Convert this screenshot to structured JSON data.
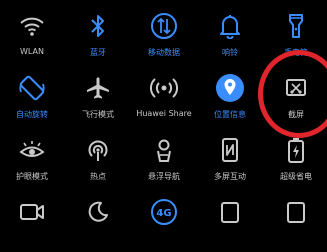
{
  "rows": [
    [
      {
        "label": "WLAN",
        "icon": "wifi-icon",
        "active": false
      },
      {
        "label": "蓝牙",
        "icon": "bluetooth-icon",
        "active": true
      },
      {
        "label": "移动数据",
        "icon": "mobile-data-icon",
        "active": true
      },
      {
        "label": "响铃",
        "icon": "bell-icon",
        "active": true
      },
      {
        "label": "手电筒",
        "icon": "flashlight-icon",
        "active": true
      }
    ],
    [
      {
        "label": "自动旋转",
        "icon": "auto-rotate-icon",
        "active": true
      },
      {
        "label": "飞行模式",
        "icon": "airplane-icon",
        "active": false
      },
      {
        "label": "Huawei Share",
        "icon": "huawei-share-icon",
        "active": false
      },
      {
        "label": "位置信息",
        "icon": "location-icon",
        "active": true
      },
      {
        "label": "截屏",
        "icon": "screenshot-icon",
        "active": false
      }
    ],
    [
      {
        "label": "护眼模式",
        "icon": "eye-comfort-icon",
        "active": false
      },
      {
        "label": "热点",
        "icon": "hotspot-icon",
        "active": false
      },
      {
        "label": "悬浮导航",
        "icon": "floating-nav-icon",
        "active": false
      },
      {
        "label": "多屏互动",
        "icon": "multi-screen-icon",
        "active": false
      },
      {
        "label": "超级省电",
        "icon": "super-power-saving-icon",
        "active": false
      }
    ],
    [
      {
        "label": "",
        "icon": "screen-record-icon",
        "active": false
      },
      {
        "label": "",
        "icon": "do-not-disturb-icon",
        "active": false
      },
      {
        "label": "4G",
        "icon": "network-4g-icon",
        "active": true
      },
      {
        "label": "",
        "icon": "nfc-icon",
        "active": false
      },
      {
        "label": "",
        "icon": "more-icon",
        "active": false
      }
    ]
  ],
  "colors": {
    "active": "#3a8dff",
    "inactive": "#c9c9c9",
    "background": "#000000",
    "annotation": "#e0262c"
  }
}
